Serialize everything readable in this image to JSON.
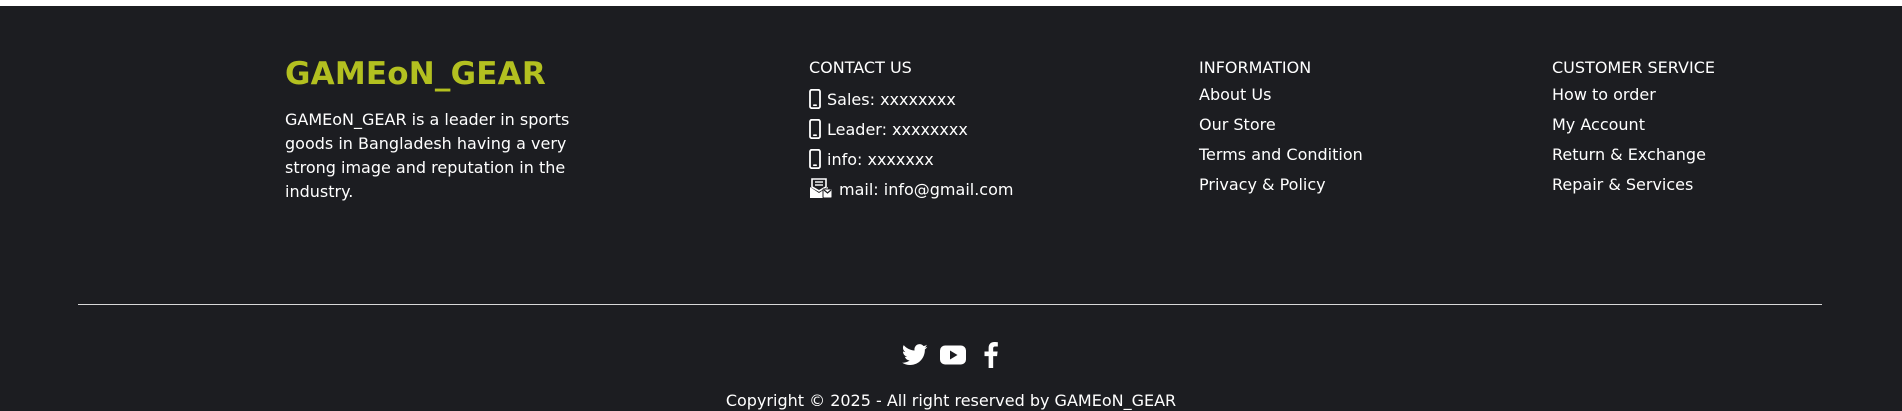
{
  "brand": {
    "title": "GAMEoN_GEAR",
    "description": "GAMEoN_GEAR is a leader in sports goods in Bangladesh having a very strong image and reputation in the industry."
  },
  "contact": {
    "heading": "CONTACT US",
    "items": [
      {
        "icon": "phone-icon",
        "text": "Sales: xxxxxxxx"
      },
      {
        "icon": "phone-icon",
        "text": "Leader: xxxxxxxx"
      },
      {
        "icon": "phone-icon",
        "text": "info: xxxxxxx"
      },
      {
        "icon": "mail-icon",
        "text": "mail: info@gmail.com"
      }
    ]
  },
  "information": {
    "heading": "INFORMATION",
    "links": [
      "About Us",
      "Our Store",
      "Terms and Condition",
      "Privacy & Policy"
    ]
  },
  "customer_service": {
    "heading": "CUSTOMER SERVICE",
    "links": [
      "How to order",
      "My Account",
      "Return & Exchange",
      "Repair & Services"
    ]
  },
  "social": {
    "icons": [
      "twitter-icon",
      "youtube-icon",
      "facebook-icon"
    ]
  },
  "footer": {
    "copyright": "Copyright © 2025 - All right reserved by GAMEoN_GEAR"
  },
  "colors": {
    "background": "#1c1d21",
    "brand_accent": "#b3c020",
    "text": "#ffffff"
  }
}
